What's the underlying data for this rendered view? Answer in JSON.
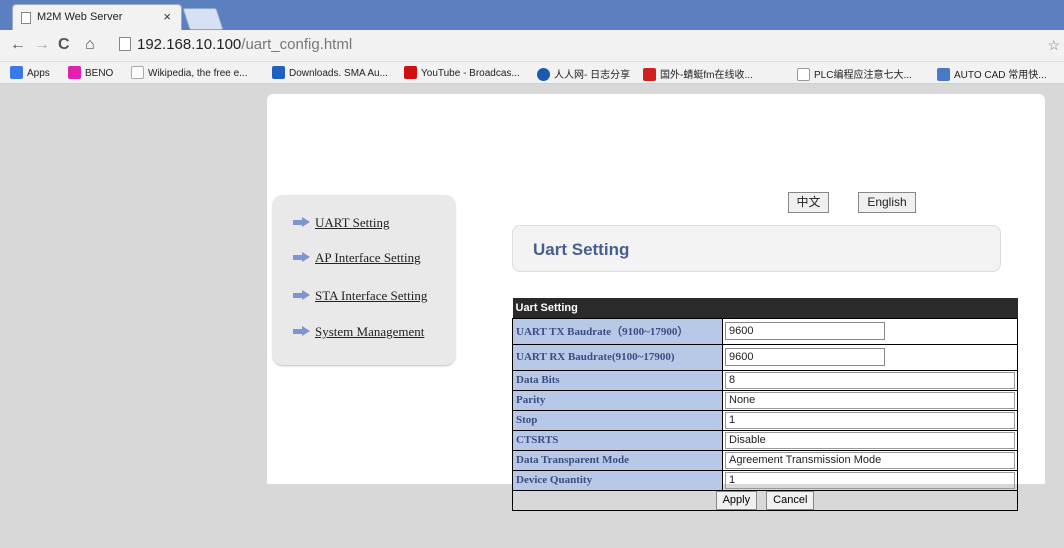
{
  "browser": {
    "tab_title": "M2M Web Server",
    "tab_close": "×",
    "url_host": "192.168.10.100",
    "url_path": "/uart_config.html",
    "bookmarks": [
      {
        "label": "Apps",
        "color": "#3b78e7"
      },
      {
        "label": "BENO",
        "color": "#e020b0"
      },
      {
        "label": "Wikipedia, the free e...",
        "color": "#ffffff"
      },
      {
        "label": "Downloads. SMA Au...",
        "color": "#2060c0"
      },
      {
        "label": "YouTube - Broadcas...",
        "color": "#d01010"
      },
      {
        "label": "人人网- 日志分享",
        "color": "#1a5bb0"
      },
      {
        "label": "国外-蜻蜓fm在线收...",
        "color": "#d02020"
      },
      {
        "label": "PLC编程应注意七大...",
        "color": "#ffffff"
      },
      {
        "label": "AUTO CAD 常用快...",
        "color": "#4a78c8"
      }
    ]
  },
  "lang": {
    "chinese": "中文",
    "english": "English"
  },
  "sidebar": {
    "items": [
      {
        "label": "UART Setting"
      },
      {
        "label": "AP Interface Setting"
      },
      {
        "label": "STA Interface Setting"
      },
      {
        "label": "System Management"
      }
    ]
  },
  "heading": "Uart Setting",
  "table": {
    "header": "Uart Setting",
    "rows": {
      "tx_label": "UART TX Baudrate（9100~17900）",
      "tx_value": "9600",
      "rx_label": "UART RX Baudrate(9100~17900)",
      "rx_value": "9600",
      "databits_label": "Data Bits",
      "databits_value": "8",
      "parity_label": "Parity",
      "parity_value": "None",
      "stop_label": "Stop",
      "stop_value": "1",
      "ctsrts_label": "CTSRTS",
      "ctsrts_value": "Disable",
      "mode_label": "Data Transparent Mode",
      "mode_value": "Agreement Transmission Mode",
      "qty_label": "Device Quantity",
      "qty_value": "1"
    },
    "apply": "Apply",
    "cancel": "Cancel"
  }
}
